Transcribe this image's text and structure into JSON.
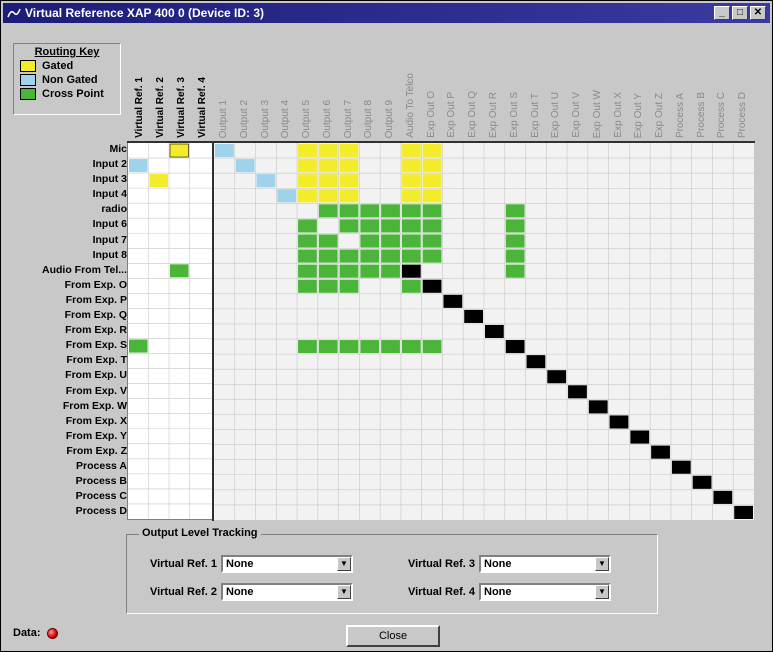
{
  "window": {
    "title": "Virtual Reference XAP 400 0 (Device ID: 3)",
    "buttons": [
      "_",
      "□",
      "✕"
    ]
  },
  "legend": {
    "title": "Routing Key",
    "items": [
      {
        "label": "Gated",
        "color": "#f2ec2a"
      },
      {
        "label": "Non Gated",
        "color": "#9fd3ec"
      },
      {
        "label": "Cross Point",
        "color": "#4bb53a"
      }
    ]
  },
  "virtual_refs": [
    "Virtual Ref. 1",
    "Virtual Ref. 2",
    "Virtual Ref. 3",
    "Virtual Ref. 4"
  ],
  "outputs": [
    "Output 1",
    "Output 2",
    "Output 3",
    "Output 4",
    "Output 5",
    "Output 6",
    "Output 7",
    "Output 8",
    "Output 9",
    "Audio To Telco",
    "Exp Out O",
    "Exp Out P",
    "Exp Out Q",
    "Exp Out R",
    "Exp Out S",
    "Exp Out T",
    "Exp Out U",
    "Exp Out V",
    "Exp Out W",
    "Exp Out X",
    "Exp Out Y",
    "Exp Out Z",
    "Process A",
    "Process B",
    "Process C",
    "Process D"
  ],
  "inputs": [
    "Mic",
    "Input 2",
    "Input 3",
    "Input 4",
    "radio",
    "Input 6",
    "Input 7",
    "Input 8",
    "Audio From Tel...",
    "From Exp. O",
    "From Exp. P",
    "From Exp. Q",
    "From Exp. R",
    "From Exp. S",
    "From Exp. T",
    "From Exp. U",
    "From Exp. V",
    "From Exp. W",
    "From Exp. X",
    "From Exp. Y",
    "From Exp. Z",
    "Process A",
    "Process B",
    "Process C",
    "Process D"
  ],
  "output_level_tracking": {
    "title": "Output Level Tracking",
    "fields": [
      {
        "label": "Virtual Ref. 1",
        "value": "None"
      },
      {
        "label": "Virtual Ref. 2",
        "value": "None"
      },
      {
        "label": "Virtual Ref. 3",
        "value": "None"
      },
      {
        "label": "Virtual Ref. 4",
        "value": "None"
      }
    ]
  },
  "status": {
    "label": "Data:",
    "led_color": "#d00000"
  },
  "close_button": "Close"
}
